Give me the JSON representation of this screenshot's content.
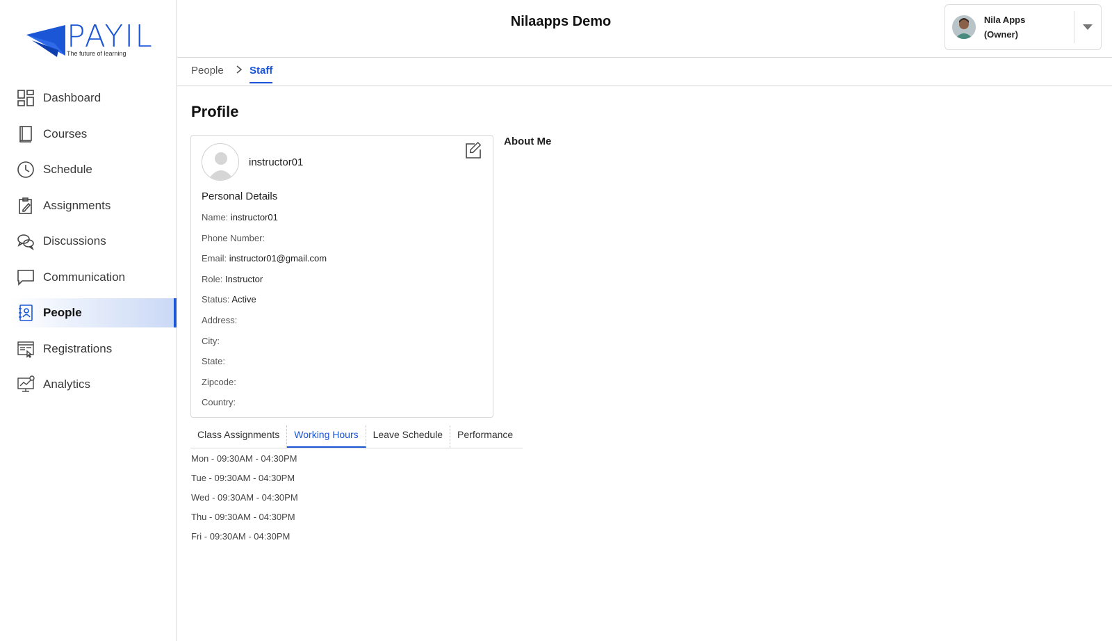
{
  "brand": {
    "name": "PAYIL",
    "tagline": "The future of learning",
    "accent": "#1a56d6"
  },
  "sidebar": {
    "items": [
      {
        "label": "Dashboard",
        "icon": "dashboard-icon"
      },
      {
        "label": "Courses",
        "icon": "book-icon"
      },
      {
        "label": "Schedule",
        "icon": "clock-icon"
      },
      {
        "label": "Assignments",
        "icon": "clipboard-edit-icon"
      },
      {
        "label": "Discussions",
        "icon": "chat-bubbles-icon"
      },
      {
        "label": "Communication",
        "icon": "message-icon"
      },
      {
        "label": "People",
        "icon": "contact-book-icon",
        "active": true
      },
      {
        "label": "Registrations",
        "icon": "registration-form-icon"
      },
      {
        "label": "Analytics",
        "icon": "analytics-icon"
      }
    ]
  },
  "header": {
    "title": "Nilaapps Demo",
    "user": {
      "name": "Nila Apps",
      "role": "(Owner)"
    }
  },
  "breadcrumb": {
    "parent": "People",
    "current": "Staff"
  },
  "profile": {
    "title": "Profile",
    "username": "instructor01",
    "section_title": "Personal Details",
    "details": [
      {
        "label": "Name:",
        "value": "instructor01"
      },
      {
        "label": "Phone Number:",
        "value": ""
      },
      {
        "label": "Email:",
        "value": "instructor01@gmail.com"
      },
      {
        "label": "Role:",
        "value": "Instructor"
      },
      {
        "label": "Status:",
        "value": "Active"
      },
      {
        "label": "Address:",
        "value": ""
      },
      {
        "label": "City:",
        "value": ""
      },
      {
        "label": "State:",
        "value": ""
      },
      {
        "label": "Zipcode:",
        "value": ""
      },
      {
        "label": "Country:",
        "value": ""
      }
    ],
    "about_title": "About Me"
  },
  "tabs": [
    {
      "label": "Class Assignments"
    },
    {
      "label": "Working Hours",
      "active": true
    },
    {
      "label": "Leave Schedule"
    },
    {
      "label": "Performance"
    }
  ],
  "working_hours": [
    "Mon - 09:30AM - 04:30PM",
    "Tue - 09:30AM - 04:30PM",
    "Wed - 09:30AM - 04:30PM",
    "Thu - 09:30AM - 04:30PM",
    "Fri - 09:30AM - 04:30PM"
  ]
}
